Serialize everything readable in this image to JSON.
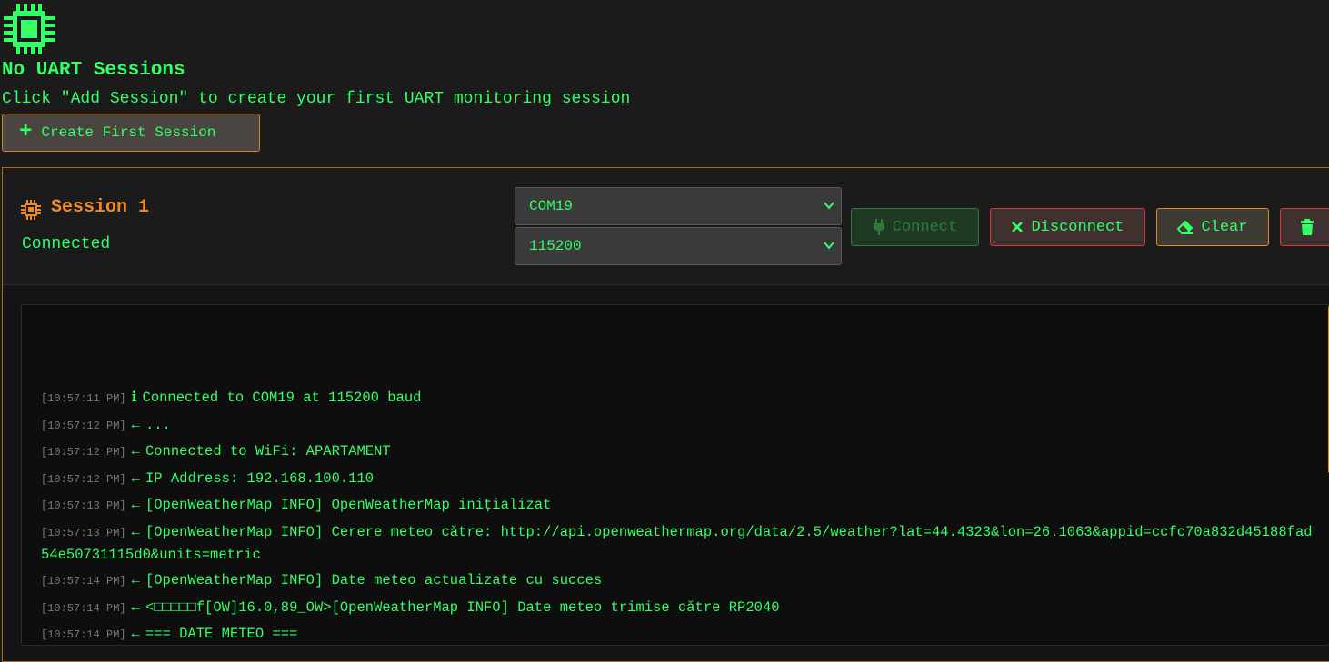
{
  "empty_state": {
    "title": "No UART Sessions",
    "hint": "Click \"Add Session\" to create your first UART monitoring session",
    "create_button": "Create First Session",
    "icon": "chip-icon"
  },
  "session": {
    "name": "Session 1",
    "status": "Connected",
    "port": "COM19",
    "baud": "115200",
    "buttons": {
      "connect": "Connect",
      "disconnect": "Disconnect",
      "clear": "Clear"
    },
    "log": [
      {
        "ts": "[10:57:11 PM]",
        "dir": "ℹ",
        "text": "Connected to COM19 at 115200 baud"
      },
      {
        "ts": "[10:57:12 PM]",
        "dir": "←",
        "text": "..."
      },
      {
        "ts": "[10:57:12 PM]",
        "dir": "←",
        "text": "Connected to WiFi: APARTAMENT"
      },
      {
        "ts": "[10:57:12 PM]",
        "dir": "←",
        "text": "IP Address: 192.168.100.110"
      },
      {
        "ts": "[10:57:13 PM]",
        "dir": "←",
        "text": "[OpenWeatherMap INFO] OpenWeatherMap inițializat"
      },
      {
        "ts": "[10:57:13 PM]",
        "dir": "←",
        "text": "[OpenWeatherMap INFO] Cerere meteo către: http://api.openweathermap.org/data/2.5/weather?lat=44.4323&lon=26.1063&appid=ccfc70a832d45188fad54e50731115d0&units=metric"
      },
      {
        "ts": "[10:57:14 PM]",
        "dir": "←",
        "text": "[OpenWeatherMap INFO] Date meteo actualizate cu succes"
      },
      {
        "ts": "[10:57:14 PM]",
        "dir": "←",
        "text": "<□□□□□f[OW]16.0,89_OW>[OpenWeatherMap INFO] Date meteo trimise către RP2040"
      },
      {
        "ts": "[10:57:14 PM]",
        "dir": "←",
        "text": "=== DATE METEO ==="
      }
    ]
  },
  "colors": {
    "accent_green": "#33ff66",
    "accent_orange": "#f08a24",
    "danger_red": "#d83a3a",
    "background": "#1b1b1b"
  }
}
